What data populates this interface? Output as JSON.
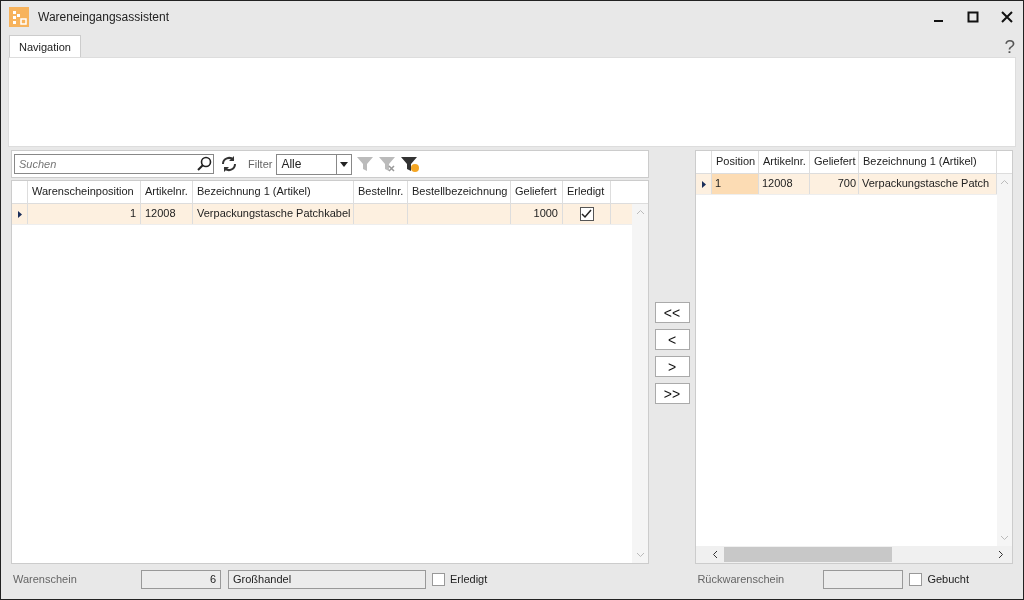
{
  "window": {
    "title": "Wareneingangsassistent"
  },
  "tabs": [
    {
      "label": "Navigation",
      "selected": true
    }
  ],
  "help": "?",
  "left_grid": {
    "search": {
      "placeholder": "Suchen"
    },
    "filter_label": "Filter",
    "filter_value": "Alle",
    "columns": [
      {
        "label": "Warenscheinposition",
        "kind": "number"
      },
      {
        "label": "Artikelnr.",
        "kind": "text"
      },
      {
        "label": "Bezeichnung 1 (Artikel)",
        "kind": "text"
      },
      {
        "label": "Bestellnr.",
        "kind": "text"
      },
      {
        "label": "Bestellbezeichnung",
        "kind": "text"
      },
      {
        "label": "Geliefert",
        "kind": "number"
      },
      {
        "label": "Erledigt",
        "kind": "check"
      }
    ],
    "rows": [
      {
        "selected": true,
        "cells": [
          "1",
          "12008",
          "Verpackungstasche Patchkabel",
          "",
          "",
          "1000"
        ],
        "checked": true
      }
    ]
  },
  "transfer_buttons": [
    "<<",
    "<",
    ">",
    ">>"
  ],
  "right_grid": {
    "columns": [
      {
        "label": "Position",
        "kind": "text"
      },
      {
        "label": "Artikelnr.",
        "kind": "text"
      },
      {
        "label": "Geliefert",
        "kind": "number"
      },
      {
        "label": "Bezeichnung 1 (Artikel)",
        "kind": "text"
      }
    ],
    "rows": [
      {
        "selected": true,
        "cells": [
          "1",
          "12008",
          "700",
          "Verpackungstasche Patch"
        ]
      }
    ]
  },
  "footer": {
    "warenschein_label": "Warenschein",
    "warenschein_number": "6",
    "warenschein_name": "Großhandel",
    "erledigt": {
      "label": "Erledigt",
      "checked": false
    },
    "rueck_label": "Rückwarenschein",
    "gebucht": {
      "label": "Gebucht",
      "checked": false
    }
  }
}
